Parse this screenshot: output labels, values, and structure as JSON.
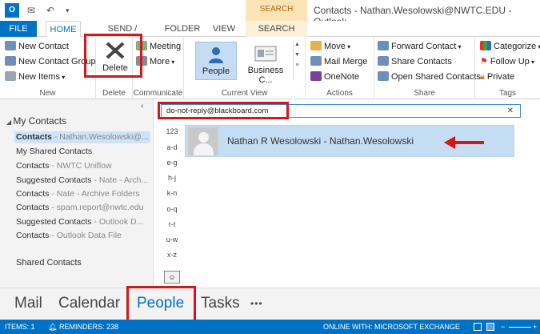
{
  "titlebar": {
    "logo": "O",
    "search_tools": "SEARCH TOOLS",
    "title": "Contacts - Nathan.Wesolowski@NWTC.EDU - Outlook"
  },
  "tabs": {
    "file": "FILE",
    "home": "HOME",
    "send_receive": "SEND / RECEIVE",
    "folder": "FOLDER",
    "view": "VIEW",
    "search": "SEARCH"
  },
  "ribbon": {
    "new_group": {
      "label": "New",
      "new_contact": "New Contact",
      "new_contact_group": "New Contact Group",
      "new_items": "New Items"
    },
    "delete_group": {
      "label": "Delete",
      "delete": "Delete"
    },
    "communicate_group": {
      "label": "Communicate",
      "meeting": "Meeting",
      "more": "More"
    },
    "current_view_group": {
      "label": "Current View",
      "people": "People",
      "business_card": "Business C..."
    },
    "actions_group": {
      "label": "Actions",
      "move": "Move",
      "mail_merge": "Mail Merge",
      "onenote": "OneNote"
    },
    "share_group": {
      "label": "Share",
      "forward_contact": "Forward Contact",
      "share_contacts": "Share Contacts",
      "open_shared_contacts": "Open Shared Contacts"
    },
    "tags_group": {
      "label": "Tags",
      "categorize": "Categorize",
      "follow_up": "Follow Up",
      "private": "Private"
    }
  },
  "nav": {
    "header": "My Contacts",
    "items": [
      {
        "name": "Contacts",
        "sub": " - Nathan.Wesolowski@..."
      },
      {
        "name": "My Shared Contacts",
        "sub": ""
      },
      {
        "name": "Contacts",
        "sub": " - NWTC Uniflow"
      },
      {
        "name": "Suggested Contacts",
        "sub": " - Nate - Arch..."
      },
      {
        "name": "Contacts",
        "sub": " - Nate - Archive Folders"
      },
      {
        "name": "Contacts",
        "sub": " - spam.report@nwtc.edu"
      },
      {
        "name": "Suggested Contacts",
        "sub": " - Outlook D..."
      },
      {
        "name": "Contacts",
        "sub": " - Outlook Data File"
      }
    ],
    "shared": "Shared Contacts"
  },
  "content": {
    "search_value": "do-not-reply@blackboard.com",
    "search_close": "✕",
    "alpha_index": [
      "123",
      "a-d",
      "e-g",
      "h-j",
      "k-n",
      "o-q",
      "r-t",
      "u-w",
      "x-z"
    ],
    "contact_name": "Nathan R Wesolowski - Nathan.Wesolowski"
  },
  "modules": {
    "mail": "Mail",
    "calendar": "Calendar",
    "people": "People",
    "tasks": "Tasks",
    "more": "•••"
  },
  "status": {
    "items": "ITEMS: 1",
    "reminders": "REMINDERS: 238",
    "online": "ONLINE WITH: MICROSOFT EXCHANGE"
  },
  "colors": {
    "accent": "#0072c6",
    "highlight_red": "#d4171b",
    "selection": "#c5ddf3"
  }
}
